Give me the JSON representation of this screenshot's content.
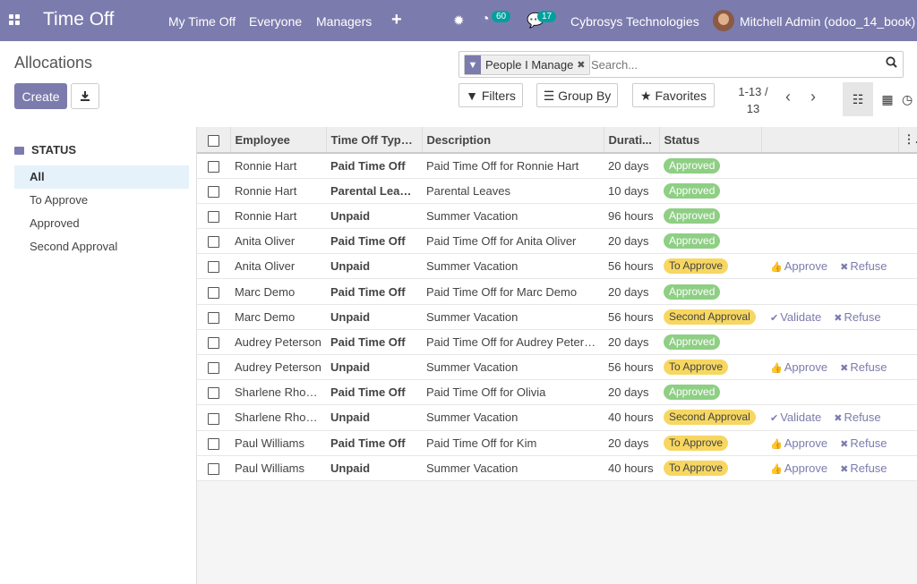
{
  "navbar": {
    "app_title": "Time Off",
    "menus": [
      "My Time Off",
      "Everyone",
      "Managers"
    ],
    "activity_count": "60",
    "message_count": "17",
    "company": "Cybrosys Technologies",
    "user": "Mitchell Admin (odoo_14_book)",
    "accent_color": "#7c7bad"
  },
  "control": {
    "title": "Allocations",
    "create_label": "Create",
    "facet_label": "People I Manage",
    "search_placeholder": "Search...",
    "filters_label": "Filters",
    "groupby_label": "Group By",
    "favorites_label": "Favorites",
    "pager_range": "1-13 /",
    "pager_total": "13"
  },
  "sidebar": {
    "heading": "STATUS",
    "items": [
      "All",
      "To Approve",
      "Approved",
      "Second Approval"
    ]
  },
  "table": {
    "columns": [
      "Employee",
      "Time Off Type...",
      "Description",
      "Durati...",
      "Status"
    ],
    "rows": [
      {
        "employee": "Ronnie Hart",
        "type": "Paid Time Off",
        "description": "Paid Time Off for Ronnie Hart",
        "duration": "20 days",
        "status": "Approved",
        "actions": []
      },
      {
        "employee": "Ronnie Hart",
        "type": "Parental Leaves",
        "description": "Parental Leaves",
        "duration": "10 days",
        "status": "Approved",
        "actions": []
      },
      {
        "employee": "Ronnie Hart",
        "type": "Unpaid",
        "description": "Summer Vacation",
        "duration": "96 hours",
        "status": "Approved",
        "actions": []
      },
      {
        "employee": "Anita Oliver",
        "type": "Paid Time Off",
        "description": "Paid Time Off for Anita Oliver",
        "duration": "20 days",
        "status": "Approved",
        "actions": []
      },
      {
        "employee": "Anita Oliver",
        "type": "Unpaid",
        "description": "Summer Vacation",
        "duration": "56 hours",
        "status": "To Approve",
        "actions": [
          "Approve",
          "Refuse"
        ]
      },
      {
        "employee": "Marc Demo",
        "type": "Paid Time Off",
        "description": "Paid Time Off for Marc Demo",
        "duration": "20 days",
        "status": "Approved",
        "actions": []
      },
      {
        "employee": "Marc Demo",
        "type": "Unpaid",
        "description": "Summer Vacation",
        "duration": "56 hours",
        "status": "Second Approval",
        "actions": [
          "Validate",
          "Refuse"
        ]
      },
      {
        "employee": "Audrey Peterson",
        "type": "Paid Time Off",
        "description": "Paid Time Off for Audrey Peters...",
        "duration": "20 days",
        "status": "Approved",
        "actions": []
      },
      {
        "employee": "Audrey Peterson",
        "type": "Unpaid",
        "description": "Summer Vacation",
        "duration": "56 hours",
        "status": "To Approve",
        "actions": [
          "Approve",
          "Refuse"
        ]
      },
      {
        "employee": "Sharlene Rhod...",
        "type": "Paid Time Off",
        "description": "Paid Time Off for Olivia",
        "duration": "20 days",
        "status": "Approved",
        "actions": []
      },
      {
        "employee": "Sharlene Rhod...",
        "type": "Unpaid",
        "description": "Summer Vacation",
        "duration": "40 hours",
        "status": "Second Approval",
        "actions": [
          "Validate",
          "Refuse"
        ]
      },
      {
        "employee": "Paul Williams",
        "type": "Paid Time Off",
        "description": "Paid Time Off for Kim",
        "duration": "20 days",
        "status": "To Approve",
        "actions": [
          "Approve",
          "Refuse"
        ]
      },
      {
        "employee": "Paul Williams",
        "type": "Unpaid",
        "description": "Summer Vacation",
        "duration": "40 hours",
        "status": "To Approve",
        "actions": [
          "Approve",
          "Refuse"
        ]
      }
    ]
  }
}
